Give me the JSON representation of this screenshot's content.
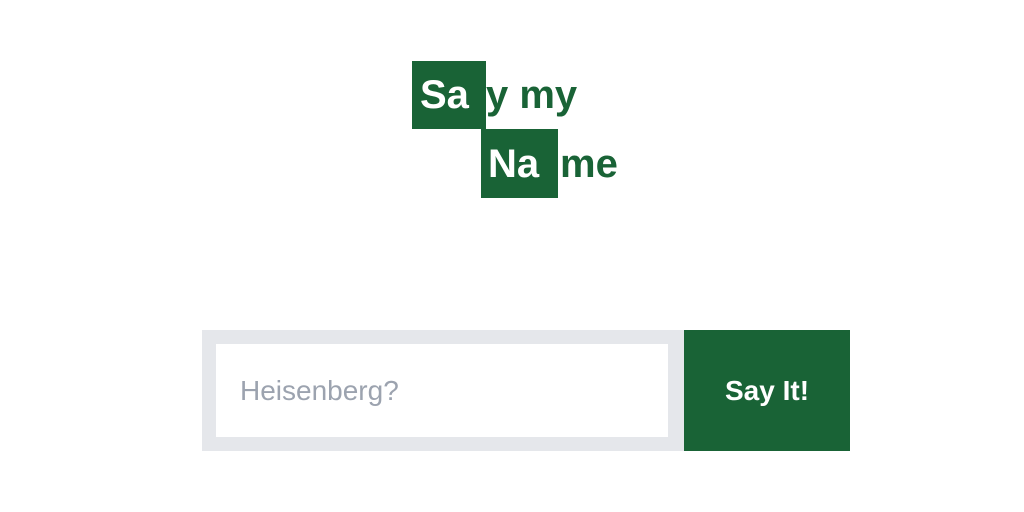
{
  "logo": {
    "line1": {
      "tile": "Sa",
      "rest": "y my"
    },
    "line2": {
      "tile": "Na",
      "rest": "me"
    }
  },
  "search": {
    "placeholder": "Heisenberg?",
    "value": ""
  },
  "submit": {
    "label": "Say It!"
  },
  "colors": {
    "brand_green": "#196336",
    "input_frame": "#e5e7eb",
    "placeholder": "#9ca3af"
  }
}
